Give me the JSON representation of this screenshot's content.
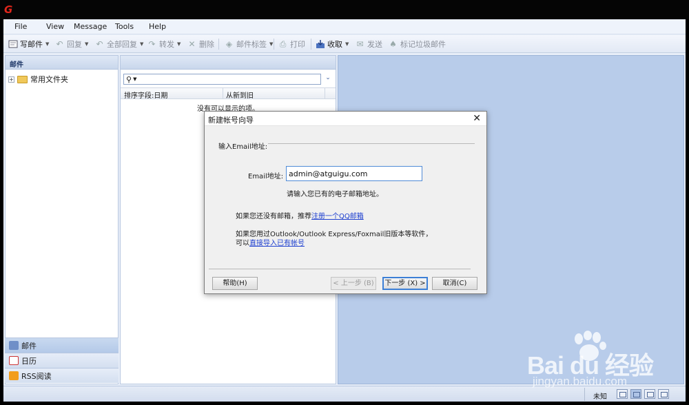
{
  "app": {
    "logo_glyph": "G"
  },
  "menu": [
    "File",
    "View",
    "Message",
    "Tools",
    "Help"
  ],
  "toolbar": {
    "compose": "写邮件",
    "reply": "回复",
    "reply_all": "全部回复",
    "forward": "转发",
    "delete": "删除",
    "tag": "邮件标签",
    "print": "打印",
    "receive": "收取",
    "send": "发送",
    "junk": "标记垃圾邮件"
  },
  "left_pane": {
    "header": "邮件",
    "tree": [
      {
        "expander": "+",
        "label": "常用文件夹"
      }
    ],
    "nav_tabs": [
      {
        "label": "邮件",
        "icon": "mail-icon",
        "active": true
      },
      {
        "label": "日历",
        "icon": "calendar-icon",
        "active": false
      },
      {
        "label": "RSS阅读",
        "icon": "rss-icon",
        "active": false
      }
    ]
  },
  "middle_pane": {
    "search_placeholder": "",
    "sort_label": "排序字段:日期",
    "order_label": "从新到旧",
    "empty_message": "没有可以显示的项。"
  },
  "status": {
    "text": "未知"
  },
  "dialog": {
    "title": "新建帐号向导",
    "section": "输入Email地址:",
    "email_label": "Email地址:",
    "email_value": "admin@atguigu.com",
    "email_hint": "请输入您已有的电子邮箱地址。",
    "no_mailbox_text": "如果您还没有邮箱，推荐",
    "register_link": "注册一个QQ邮箱",
    "used_before_text": "如果您用过Outlook/Outlook Express/Foxmail旧版本等软件，",
    "import_prefix": "可以",
    "import_link": "直接导入已有帐号",
    "buttons": {
      "help": "帮助(H)",
      "back": "< 上一步 (B)",
      "next": "下一步 (X) >",
      "cancel": "取消(C)"
    }
  },
  "watermark": {
    "brand": "Bai du 经验",
    "url": "jingyan.baidu.com"
  }
}
